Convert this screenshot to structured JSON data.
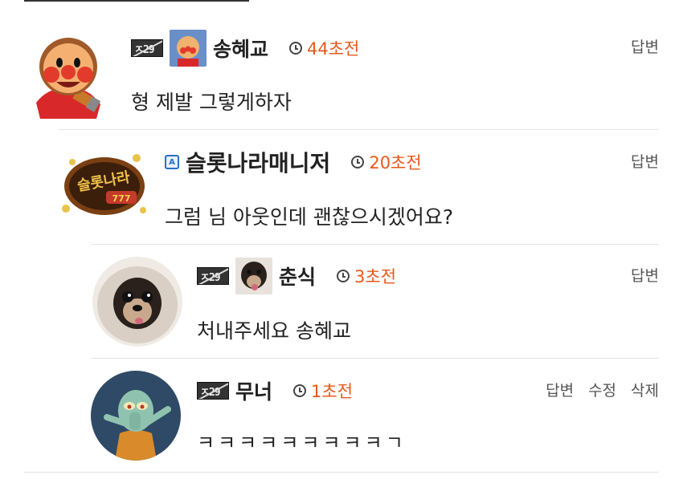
{
  "comments": [
    {
      "level_badge": "ㅈ29",
      "username": "송혜교",
      "time": "44초전",
      "text": "형 제발 그렇게하자",
      "actions": [
        "답변"
      ]
    },
    {
      "username": "슬롯나라매니저",
      "admin_badge": "A",
      "time": "20초전",
      "text": "그럼 님 아웃인데 괜찮으시겠어요?",
      "actions": [
        "답변"
      ]
    },
    {
      "level_badge": "ㅈ29",
      "username": "춘식",
      "time": "3초전",
      "text": "처내주세요 송혜교",
      "actions": [
        "답변"
      ]
    },
    {
      "level_badge": "ㅈ29",
      "username": "무너",
      "time": "1초전",
      "text": "ㅋㅋㅋㅋㅋㅋㅋㅋㅋㄱ",
      "actions": [
        "답변",
        "수정",
        "삭제"
      ]
    }
  ],
  "colors": {
    "time": "#e8581c",
    "text": "#222222",
    "divider": "#e4e4e4",
    "admin": "#2a6fc9"
  },
  "icons": [
    "clock-icon",
    "level-badge-icon",
    "admin-icon"
  ]
}
